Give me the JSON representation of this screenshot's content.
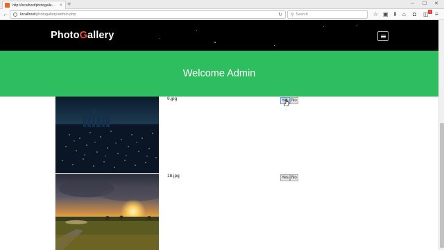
{
  "browser": {
    "tab_title": "http://localhost/photogalle...",
    "tab_close": "×",
    "new_tab": "+",
    "url_host": "localhost",
    "url_path": "/photogallery/admin.php",
    "search_placeholder": "Search",
    "notification_count": "1"
  },
  "site": {
    "brand_prefix": "Photo",
    "brand_accent": "G",
    "brand_suffix": "allery",
    "welcome": "Welcome Admin"
  },
  "photos": [
    {
      "filename": "9.jpg",
      "yes_label": "Yes",
      "no_label": "No"
    },
    {
      "filename": "18.jpg",
      "yes_label": "Yes",
      "no_label": "No"
    }
  ],
  "colors": {
    "header_bg": "#000000",
    "banner_bg": "#2fbe5f",
    "brand_accent": "#e74c3c"
  }
}
